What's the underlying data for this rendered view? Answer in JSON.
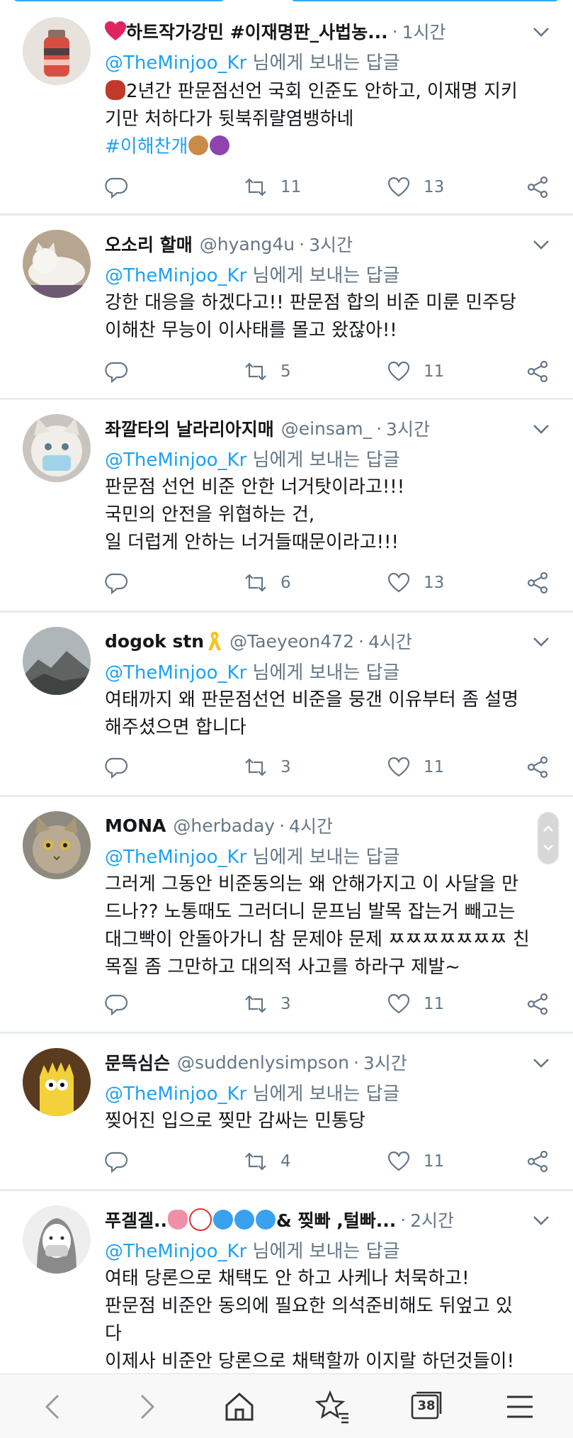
{
  "reply_prefix": "님에게 보내는 답글",
  "tweets": [
    {
      "name": "하트작가강민 #이재명판_사법농...",
      "handle": "",
      "time": "1시간",
      "mention": "@TheMinjoo_Kr",
      "lines": [
        "2년간 판문점선언 국회 인준도 안하고, 이재명 지키",
        "기만 처하다가 뒷북쥐랼염뱅하네"
      ],
      "hashtag": "#이해찬개",
      "retweets": "11",
      "likes": "13"
    },
    {
      "name": "오소리 할매",
      "handle": "@hyang4u",
      "time": "3시간",
      "mention": "@TheMinjoo_Kr",
      "lines": [
        "강한 대응을 하겠다고!! 판문점 합의 비준 미룬 민주당",
        "이해찬 무능이 이사태를 몰고 왔잖아!!"
      ],
      "retweets": "5",
      "likes": "11"
    },
    {
      "name": "좌깔타의 날라리아지매",
      "handle": "@einsam_",
      "time": "3시간",
      "mention": "@TheMinjoo_Kr",
      "lines": [
        "판문점 선언 비준 안한 너거탓이라고!!!",
        "국민의 안전을 위협하는 건,",
        "일 더럽게 안하는 너거들때문이라고!!!"
      ],
      "retweets": "6",
      "likes": "13"
    },
    {
      "name": "dogok stn",
      "handle": "@Taeyeon472",
      "time": "4시간",
      "mention": "@TheMinjoo_Kr",
      "lines": [
        "여태까지 왜 판문점선언 비준을 뭉갠 이유부터 좀 설명",
        "해주셨으면 합니다"
      ],
      "retweets": "3",
      "likes": "11"
    },
    {
      "name": "MONA",
      "handle": "@herbaday",
      "time": "4시간",
      "mention": "@TheMinjoo_Kr",
      "lines": [
        "그러게 그동안 비준동의는 왜 안해가지고 이 사달을 만",
        "드나?? 노통때도 그러더니 문프님 발목 잡는거 빼고는",
        "대그빡이 안돌아가니 참 문제야 문제 ㅉㅉㅉㅉㅉㅉㅉ 친",
        "목질 좀 그만하고 대의적 사고를 하라구 제발~"
      ],
      "retweets": "3",
      "likes": "11"
    },
    {
      "name": "문뜩심슨",
      "handle": "@suddenlysimpson",
      "time": "3시간",
      "mention": "@TheMinjoo_Kr",
      "lines": [
        "찢어진 입으로 찢만 감싸는 민통당"
      ],
      "retweets": "4",
      "likes": "11"
    },
    {
      "name_prefix": "푸겔겔..",
      "name_suffix": "& 찢빠 ,털빠...",
      "time": "2시간",
      "mention": "@TheMinjoo_Kr",
      "lines": [
        "여태 당론으로 채택도 안 하고 사케나 처묵하고!",
        "판문점 비준안 동의에 필요한 의석준비해도 뒤엎고 있",
        "다",
        "이제사 비준안 당론으로 채택할까 이지랄 하던것들이!"
      ]
    }
  ],
  "bottom_nav": {
    "tab_count": "38"
  }
}
